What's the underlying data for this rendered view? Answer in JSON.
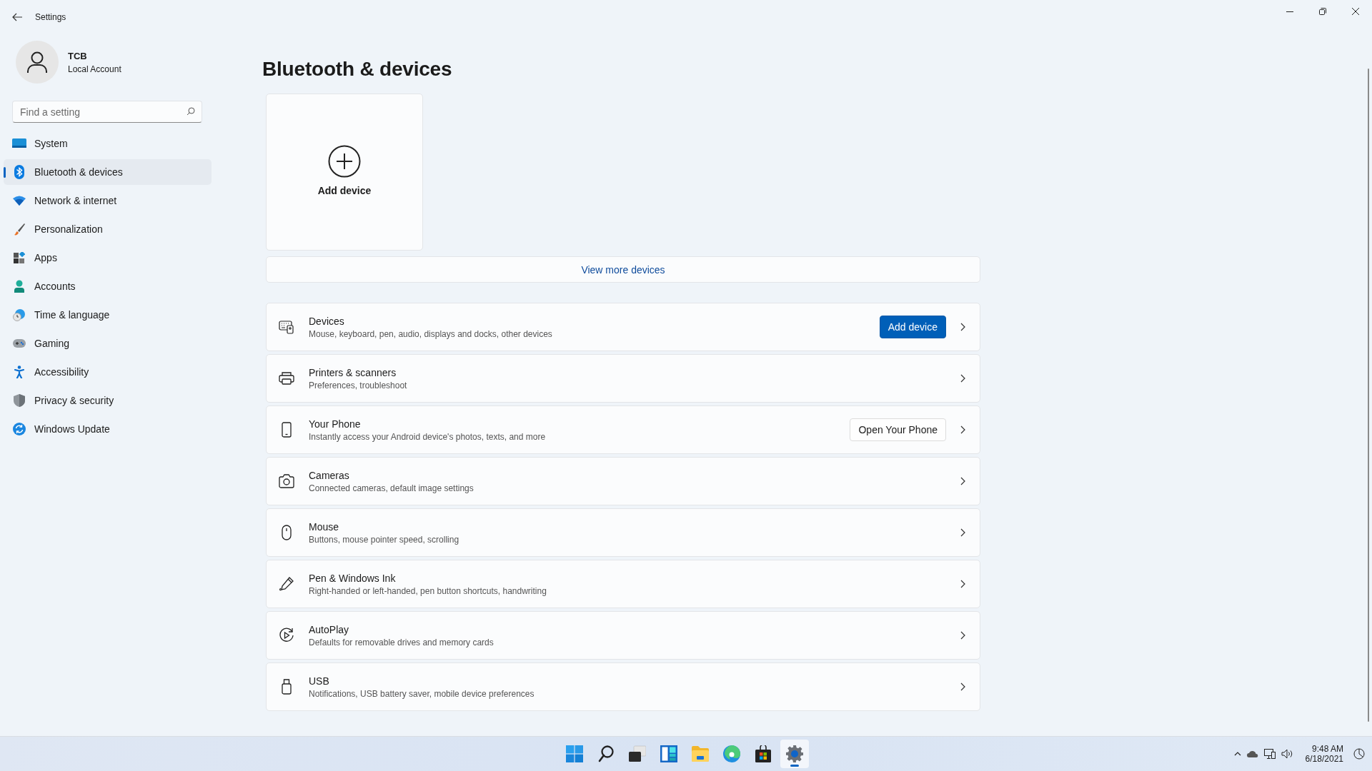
{
  "window": {
    "title": "Settings"
  },
  "account": {
    "name": "TCB",
    "type": "Local Account"
  },
  "search": {
    "placeholder": "Find a setting"
  },
  "nav": [
    {
      "label": "System",
      "selected": false
    },
    {
      "label": "Bluetooth & devices",
      "selected": true
    },
    {
      "label": "Network & internet",
      "selected": false
    },
    {
      "label": "Personalization",
      "selected": false
    },
    {
      "label": "Apps",
      "selected": false
    },
    {
      "label": "Accounts",
      "selected": false
    },
    {
      "label": "Time & language",
      "selected": false
    },
    {
      "label": "Gaming",
      "selected": false
    },
    {
      "label": "Accessibility",
      "selected": false
    },
    {
      "label": "Privacy & security",
      "selected": false
    },
    {
      "label": "Windows Update",
      "selected": false
    }
  ],
  "page_title": "Bluetooth & devices",
  "add_tile": {
    "label": "Add device"
  },
  "view_more": "View more devices",
  "settings_rows": [
    {
      "title": "Devices",
      "subtitle": "Mouse, keyboard, pen, audio, displays and docks, other devices",
      "action": {
        "label": "Add device",
        "kind": "primary"
      }
    },
    {
      "title": "Printers & scanners",
      "subtitle": "Preferences, troubleshoot"
    },
    {
      "title": "Your Phone",
      "subtitle": "Instantly access your Android device's photos, texts, and more",
      "action": {
        "label": "Open Your Phone",
        "kind": "secondary"
      }
    },
    {
      "title": "Cameras",
      "subtitle": "Connected cameras, default image settings"
    },
    {
      "title": "Mouse",
      "subtitle": "Buttons, mouse pointer speed, scrolling"
    },
    {
      "title": "Pen & Windows Ink",
      "subtitle": "Right-handed or left-handed, pen button shortcuts, handwriting"
    },
    {
      "title": "AutoPlay",
      "subtitle": "Defaults for removable drives and memory cards"
    },
    {
      "title": "USB",
      "subtitle": "Notifications, USB battery saver, mobile device preferences"
    }
  ],
  "taskbar": {
    "apps": [
      {
        "active": false
      },
      {
        "active": false
      },
      {
        "active": false
      },
      {
        "active": false
      },
      {
        "active": false
      },
      {
        "active": false
      },
      {
        "active": false
      },
      {
        "active": true
      }
    ],
    "clock": {
      "time": "9:48 AM",
      "date": "6/18/2021"
    }
  }
}
